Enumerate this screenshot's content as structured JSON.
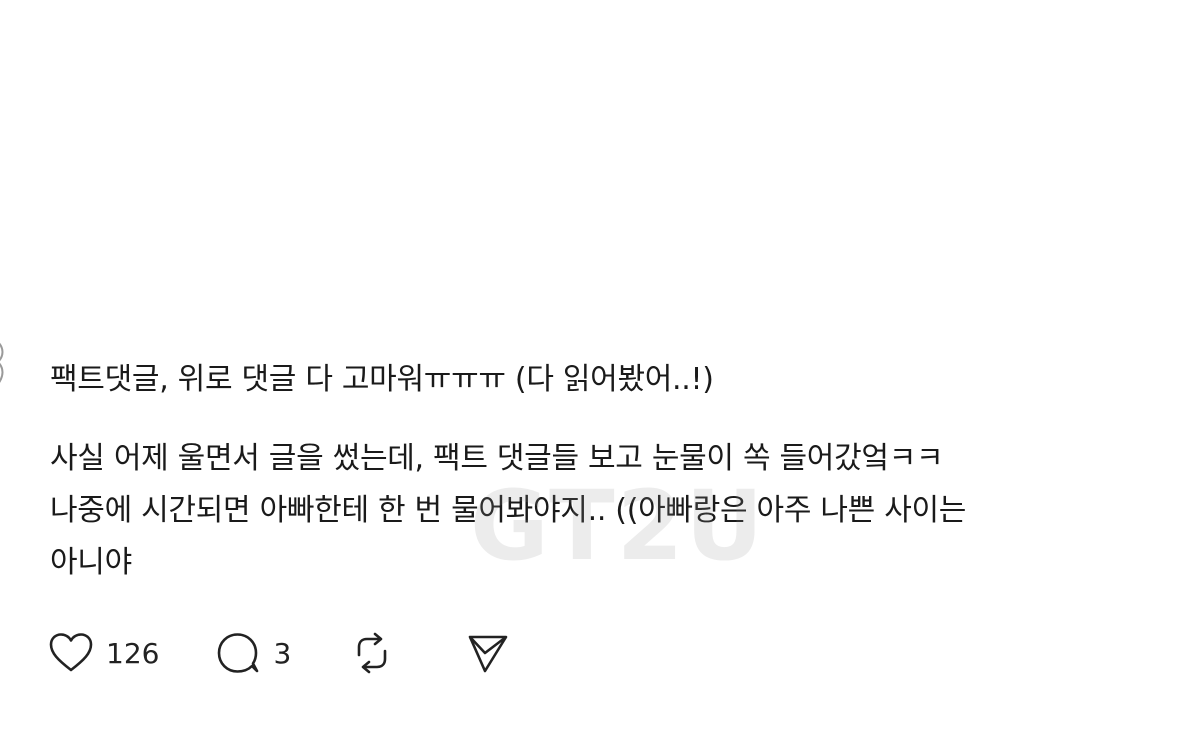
{
  "post": {
    "title": "팩트댓글, 위로 댓글 다 고마워ㅠㅠㅠ (다 읽어봤어..!)",
    "body_lines": [
      "사실 어제 울면서 글을 썼는데, 팩트 댓글들 보고 눈물이 쏙 들어갔엌ㅋㅋ",
      "나중에 시간되면 아빠한테 한 번 물어봐야지.. ((아빠랑은 아주 나쁜 사이는",
      "아니야"
    ]
  },
  "watermark": "GT2U",
  "actions": {
    "like_count": "126",
    "comment_count": "3",
    "like_icon": "heart-icon",
    "comment_icon": "speech-bubble-icon",
    "repost_icon": "repost-icon",
    "share_icon": "send-icon"
  }
}
